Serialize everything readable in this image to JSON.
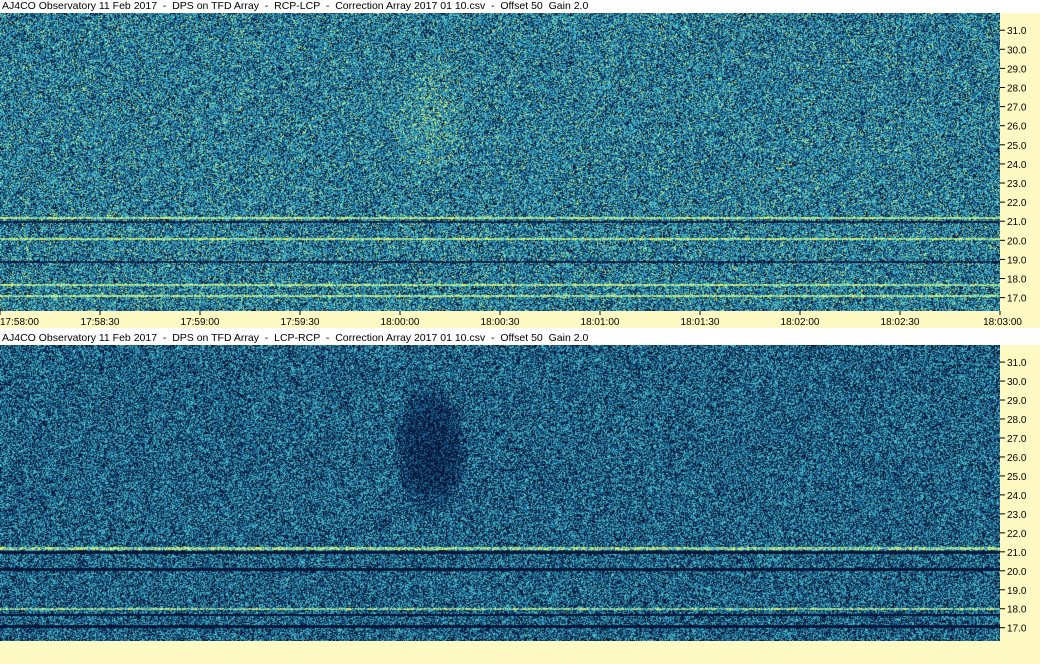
{
  "panels": [
    {
      "title": "AJ4CO Observatory 11 Feb 2017  -  DPS on TFD Array  -  RCP-LCP  -  Correction Array 2017 01 10.csv  -  Offset 50  Gain 2.0"
    },
    {
      "title": "AJ4CO Observatory 11 Feb 2017  -  DPS on TFD Array  -  LCP-RCP  -  Correction Array 2017 01 10.csv  -  Offset 50  Gain 2.0"
    }
  ],
  "colors": {
    "axis_background": "#fff9c4",
    "spectrogram_dark": "#06183a",
    "spectrogram_mid": "#1e6e9a",
    "spectrogram_light": "#4fc0c8",
    "spectrogram_hot": "#d8f070"
  },
  "chart_data": [
    {
      "type": "heatmap",
      "title": "AJ4CO Observatory 11 Feb 2017  -  DPS on TFD Array  -  RCP-LCP  -  Correction Array 2017 01 10.csv  -  Offset 50  Gain 2.0",
      "xlabel": "",
      "ylabel": "",
      "x_ticks": [
        "17:58:00",
        "17:58:30",
        "17:59:00",
        "17:59:30",
        "18:00:00",
        "18:00:30",
        "18:01:00",
        "18:01:30",
        "18:02:00",
        "18:02:30",
        "18:03:00"
      ],
      "xlim": [
        "17:58:00",
        "18:03:00"
      ],
      "y_ticks": [
        "17.0",
        "18.0",
        "19.0",
        "20.0",
        "21.0",
        "22.0",
        "23.0",
        "24.0",
        "25.0",
        "26.0",
        "27.0",
        "28.0",
        "29.0",
        "30.0",
        "31.0"
      ],
      "ylim": [
        16.3,
        31.9
      ],
      "grid": false,
      "bright_lines_y": [
        17.1,
        17.7,
        20.1,
        21.2
      ],
      "dark_lines_y": [
        18.9,
        21.0
      ]
    },
    {
      "type": "heatmap",
      "title": "AJ4CO Observatory 11 Feb 2017  -  DPS on TFD Array  -  LCP-RCP  -  Correction Array 2017 01 10.csv  -  Offset 50  Gain 2.0",
      "xlabel": "",
      "ylabel": "",
      "x_ticks": [],
      "y_ticks": [
        "17.0",
        "18.0",
        "19.0",
        "20.0",
        "21.0",
        "22.0",
        "23.0",
        "24.0",
        "25.0",
        "26.0",
        "27.0",
        "28.0",
        "29.0",
        "30.0",
        "31.0"
      ],
      "ylim": [
        16.3,
        31.9
      ],
      "grid": false,
      "bright_lines_y": [
        18.0,
        21.2
      ],
      "dark_lines_y": [
        17.1,
        17.7,
        20.1,
        21.0
      ]
    }
  ]
}
